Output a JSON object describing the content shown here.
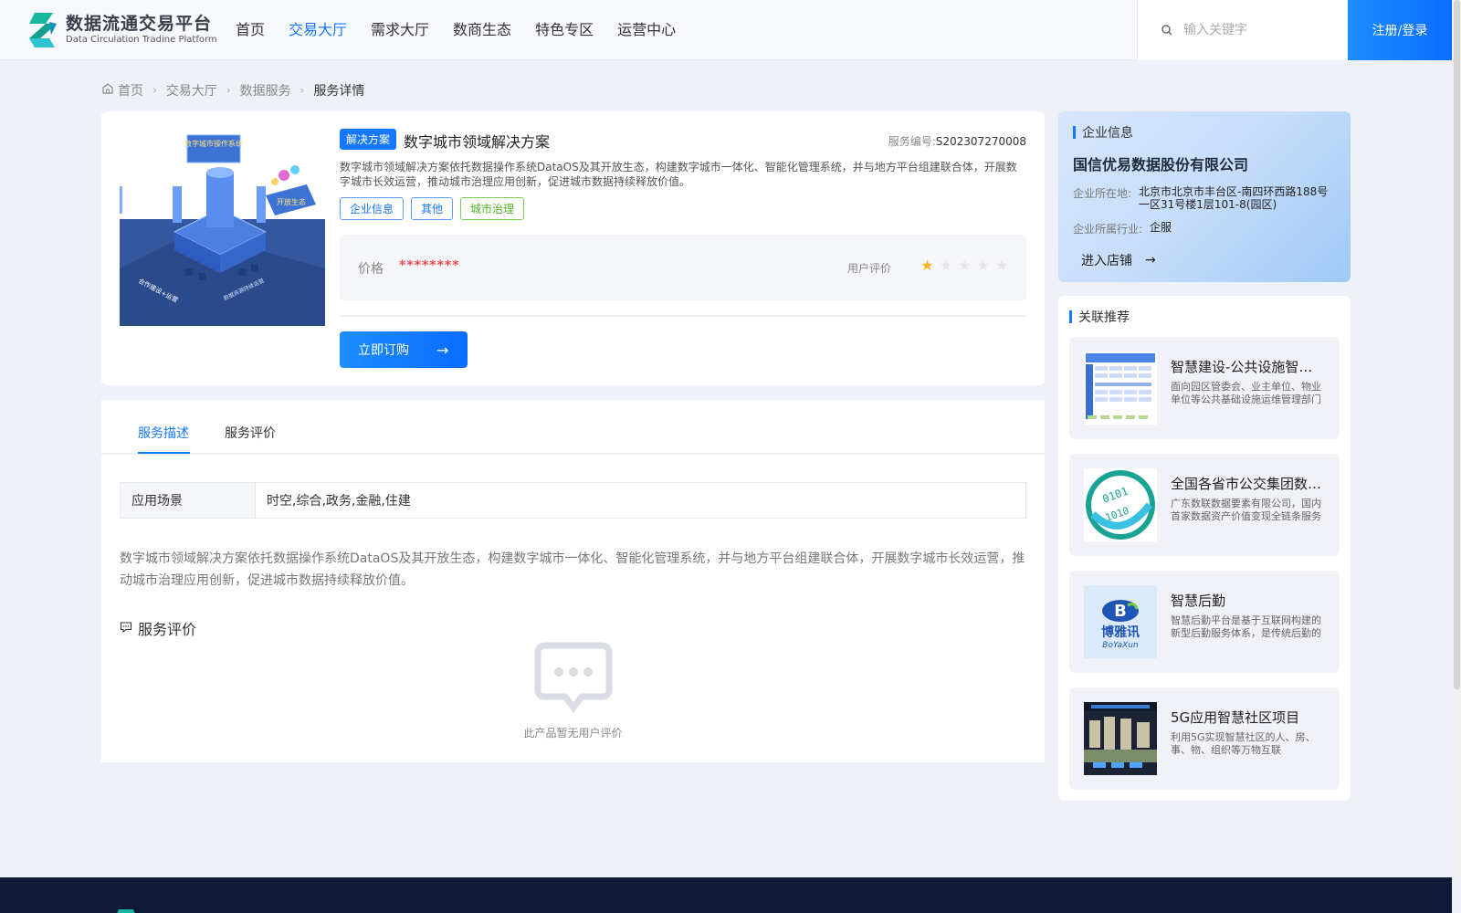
{
  "header": {
    "logo_cn": "数据流通交易平台",
    "logo_en": "Data Circulation Tradine Platform",
    "nav": [
      {
        "label": "首页",
        "active": false
      },
      {
        "label": "交易大厅",
        "active": true
      },
      {
        "label": "需求大厅",
        "active": false
      },
      {
        "label": "数商生态",
        "active": false
      },
      {
        "label": "特色专区",
        "active": false
      },
      {
        "label": "运营中心",
        "active": false
      }
    ],
    "search_placeholder": "输入关键字",
    "login_label": "注册/登录",
    "accent_color": "#1677ff"
  },
  "breadcrumb": [
    "首页",
    "交易大厅",
    "数据服务",
    "服务详情"
  ],
  "product": {
    "badge": "解决方案",
    "title": "数字城市领域解决方案",
    "service_no_label": "服务编号:",
    "service_no": "S202307270008",
    "description": "数字城市领域解决方案依托数据操作系统DataOS及其开放生态，构建数字城市一体化、智能化管理系统，并与地方平台组建联合体，开展数字城市长效运营，推动城市治理应用创新，促进城市数据持续释放价值。",
    "tags": [
      "企业信息",
      "其他",
      "城市治理"
    ],
    "price_label": "价格",
    "price_value": "********",
    "rating_label": "用户评价",
    "rating": 1,
    "rating_max": 5,
    "buy_label": "立即订购",
    "image_text": {
      "top": "数字城市操作系统",
      "side": "开放生态",
      "bottom_left": "合作建设+运营",
      "bottom_right": "数据资源持续运营"
    }
  },
  "detail": {
    "tabs": [
      {
        "label": "服务描述",
        "active": true
      },
      {
        "label": "服务评价",
        "active": false
      }
    ],
    "scene_key": "应用场景",
    "scene_value": "时空,综合,政务,金融,住建",
    "description": "数字城市领域解决方案依托数据操作系统DataOS及其开放生态，构建数字城市一体化、智能化管理系统，并与地方平台组建联合体，开展数字城市长效运营，推动城市治理应用创新，促进城市数据持续释放价值。",
    "review_title": "服务评价",
    "empty_text": "此产品暂无用户评价"
  },
  "company": {
    "section_title": "企业信息",
    "name": "国信优易数据股份有限公司",
    "location_label": "企业所在地:",
    "location": "北京市北京市丰台区-南四环西路188号一区31号楼1层101-8(园区)",
    "industry_label": "企业所属行业:",
    "industry": "企服",
    "enter_label": "进入店铺"
  },
  "recommend": {
    "section_title": "关联推荐",
    "items": [
      {
        "title": "智慧建设-公共设施智能运维",
        "desc": "面向园区管委会、业主单位、物业单位等公共基础设施运维管理部门",
        "thumb": "table-icon"
      },
      {
        "title": "全国各省市公交集团数据资产",
        "desc": "广东数联数据要素有限公司，国内首家数据资产价值变现全链条服务商",
        "thumb": "globe-binary-icon"
      },
      {
        "title": "智慧后勤",
        "desc": "智慧后勤平台是基于互联网构建的新型后勤服务体系，是传统后勤的升级",
        "thumb": "boyaxun-logo",
        "thumb_brand": "博雅讯",
        "thumb_brand_en": "BoYaXun"
      },
      {
        "title": "5G应用智慧社区项目",
        "desc": "利用5G实现智慧社区的人、房、事、物、组织等万物互联",
        "thumb": "city-photo-icon"
      }
    ]
  }
}
